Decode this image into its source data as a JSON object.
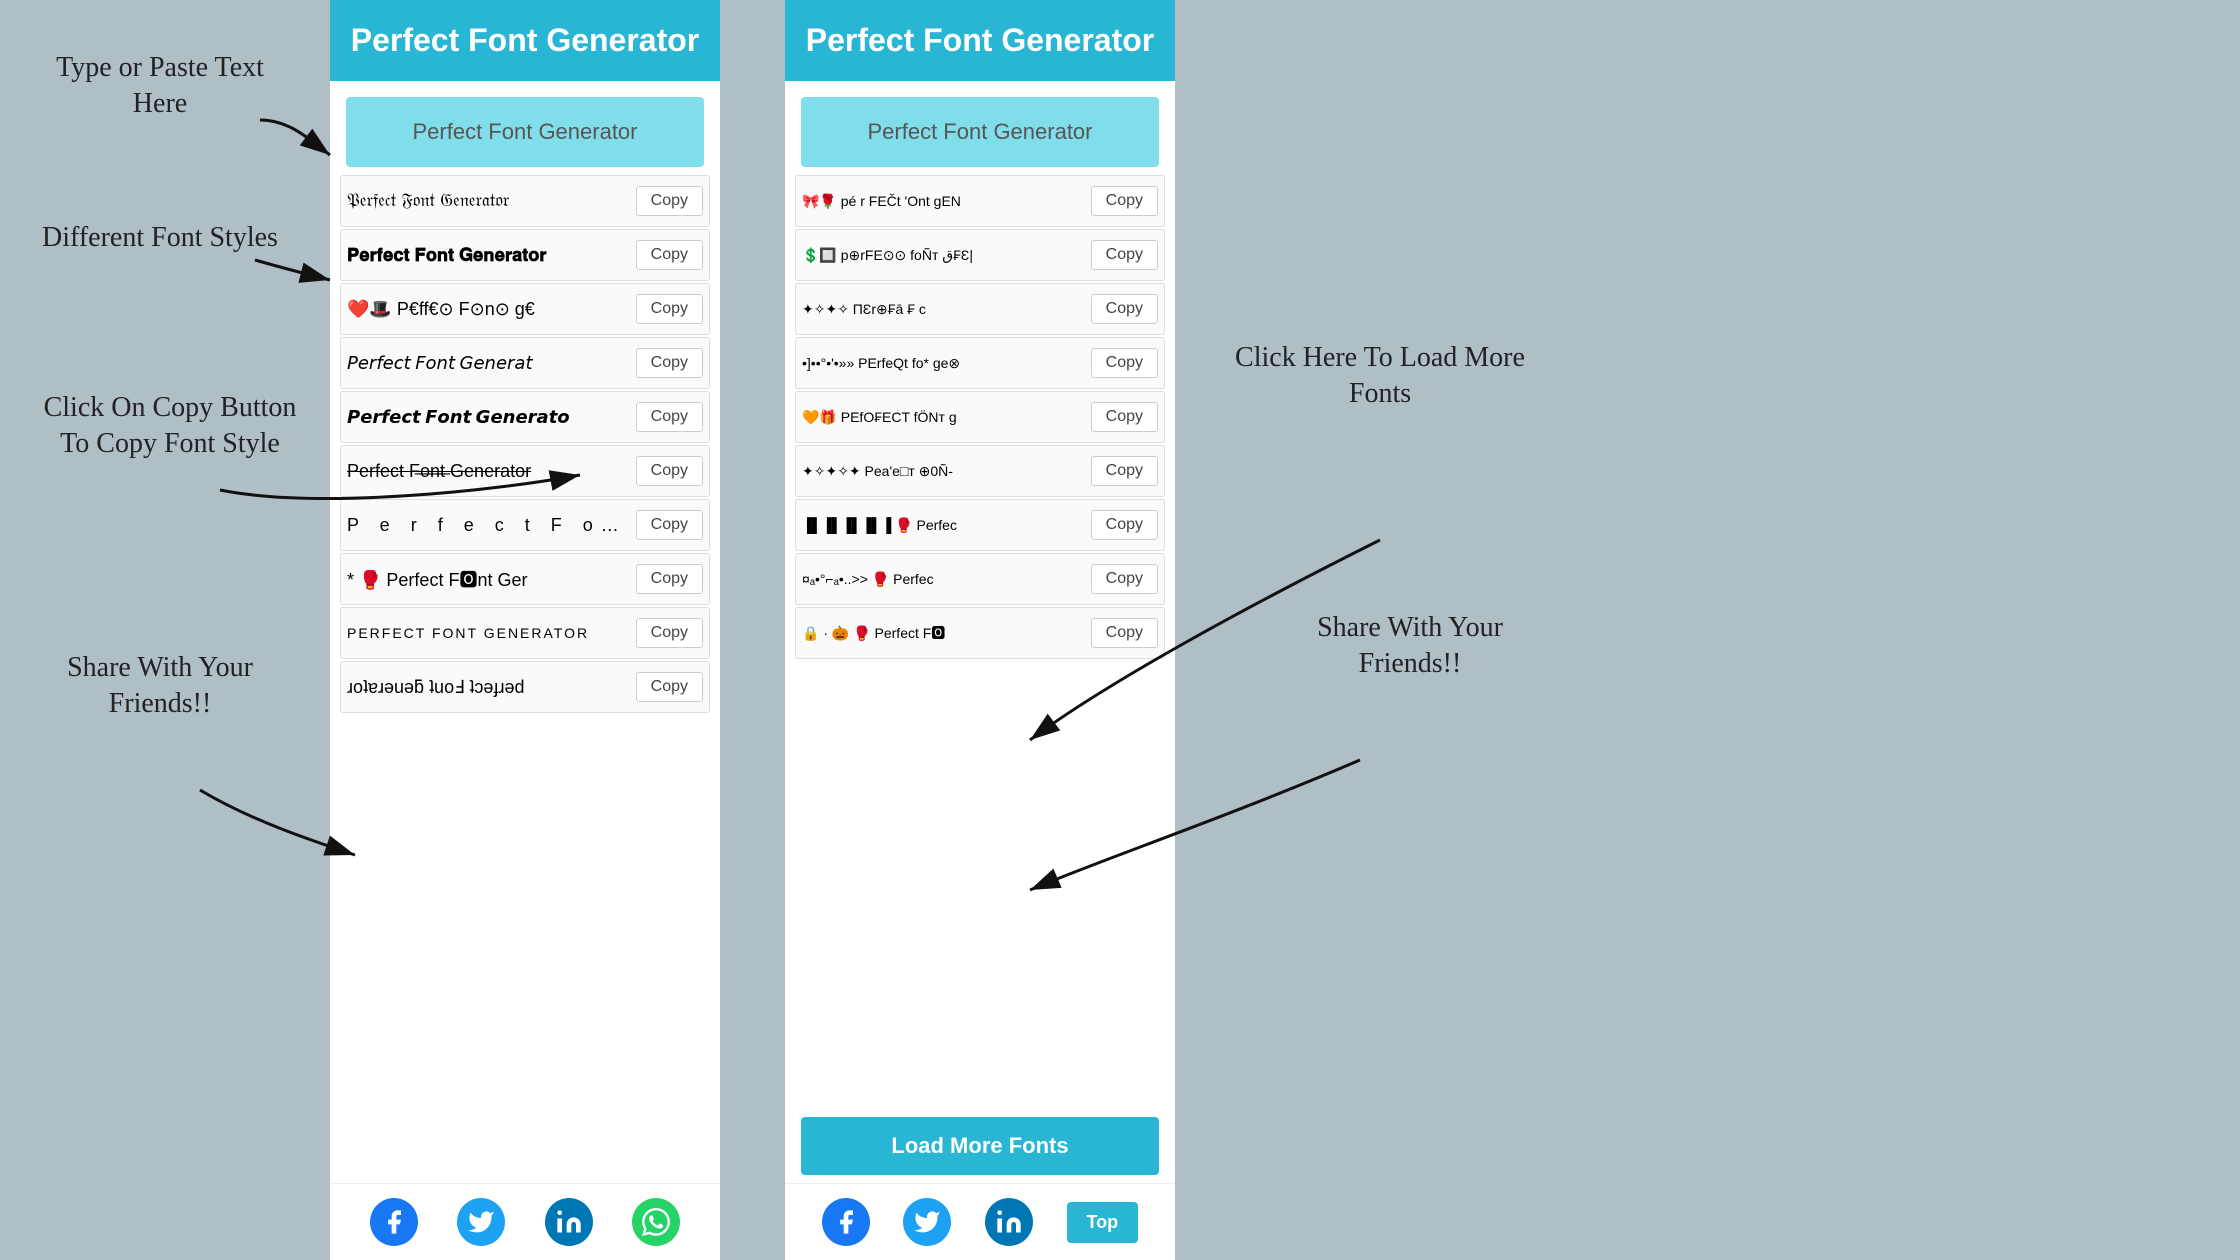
{
  "left_panel": {
    "header": "Perfect Font Generator",
    "input_placeholder": "Perfect Font Generator",
    "fonts": [
      {
        "text": "𝔓𝔢𝔯𝔣𝔢𝔠𝔱 𝔉𝔬𝔫𝔱 𝔊𝔢𝔫𝔢𝔯𝔞𝔱𝔬𝔯",
        "style": "blackletter",
        "copy": "Copy"
      },
      {
        "text": "𝐏𝐞𝐫𝐟𝐞𝐜𝐭 𝐅𝐨𝐧𝐭 𝐆𝐞𝐧𝐞𝐫𝐚𝐭𝐨𝐫",
        "style": "bold",
        "copy": "Copy"
      },
      {
        "text": "❤️🎩 P€ff€⊙ F⊙n⊙ g€",
        "style": "emoji",
        "copy": "Copy"
      },
      {
        "text": "𝘗𝘦𝘳𝘧𝘦𝘤𝘵 𝘍𝘰𝘯𝘵 𝘎𝘦𝘯𝘦𝘳𝘢𝘵",
        "style": "italic",
        "copy": "Copy"
      },
      {
        "text": "𝙋𝙚𝙧𝙛𝙚𝙘𝙩 𝙁𝙤𝙣𝙩 𝙂𝙚𝙣𝙚𝙧𝙖𝙩𝙤",
        "style": "bold-italic",
        "copy": "Copy"
      },
      {
        "text": "Perfect Fo…Generator",
        "style": "strikethrough",
        "copy": "Copy"
      },
      {
        "text": "P e r f e c t  F o n t",
        "style": "spaced",
        "copy": "Copy"
      },
      {
        "text": "* 🥊 Perfect F🅾nt Ger",
        "style": "emoji2",
        "copy": "Copy"
      },
      {
        "text": "PERFECT FONT GENERATOR",
        "style": "upper",
        "copy": "Copy"
      },
      {
        "text": "ɹoʇɐɹǝuǝƃ ʇuoℲ ʇɔǝɟɹǝd",
        "style": "reverse",
        "copy": "Copy"
      }
    ],
    "share": {
      "facebook": "f",
      "twitter": "t",
      "linkedin": "in",
      "whatsapp": "w"
    }
  },
  "right_panel": {
    "header": "Perfect Font Generator",
    "input_placeholder": "Perfect Font Generator",
    "fonts": [
      {
        "text": "🎀🌹 pé r FEČt 'Ont gEN",
        "style": "",
        "copy": "Copy"
      },
      {
        "text": "💲🔲 p⊕rFE⊙⊙ foÑт ق₣Ɛ|",
        "style": "",
        "copy": "Copy"
      },
      {
        "text": "✦✧✦✧ ΠƐr⊕₣ā ₣ c",
        "style": "",
        "copy": "Copy"
      },
      {
        "text": "•]••°•'•»» PErfeQt fo* ge⊗",
        "style": "",
        "copy": "Copy"
      },
      {
        "text": "🧡🎁 PEfO₣ECT fÖNт g",
        "style": "",
        "copy": "Copy"
      },
      {
        "text": "✦✧✦✧✦ Pеa'e□т ⊕0Ñ-",
        "style": "",
        "copy": "Copy"
      },
      {
        "text": "▐▌▐▌▐▌▐ 🥊 Perfec",
        "style": "",
        "copy": "Copy"
      },
      {
        "text": "¤ₐ•°⌐̈ₐ•..>>  🥊 Perfec",
        "style": "",
        "copy": "Copy"
      },
      {
        "text": "🔒 · 🎃 🥊 Perfect F🅾",
        "style": "",
        "copy": "Copy"
      }
    ],
    "load_more": "Load More Fonts",
    "top_btn": "Top",
    "share": {
      "facebook": "f",
      "twitter": "t",
      "linkedin": "in"
    }
  },
  "annotations": {
    "type_paste": "Type or Paste Text\nHere",
    "different_fonts": "Different Font\nStyles",
    "click_copy": "Click On Copy\nButton To Copy\nFont Style",
    "share_left": "Share With\nYour\nFriends!!",
    "click_load": "Click Here To\nLoad More\nFonts",
    "share_right": "Share With\nYour\nFriends!!"
  }
}
